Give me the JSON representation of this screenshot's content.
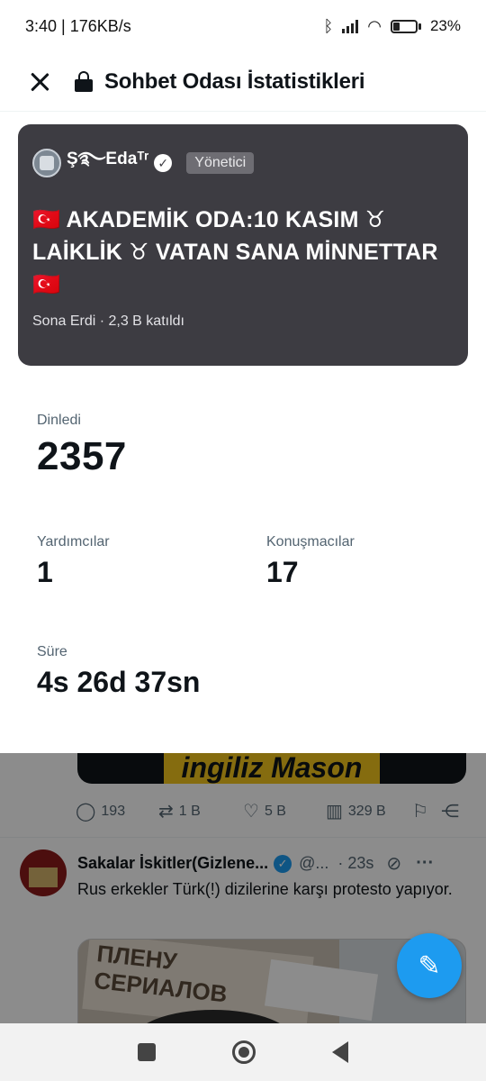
{
  "status_bar": {
    "time_speed": "3:40 | 176KB/s",
    "battery_percent": "23%"
  },
  "header": {
    "title": "Sohbet Odası İstatistikleri"
  },
  "space_card": {
    "host_name": "Ş࿐Edaᵀʳ",
    "role_badge": "Yönetici",
    "title": "🇹🇷 AKADEMİK ODA:10 KASIM ♉︎ LAİKLİK ♉︎ VATAN SANA MİNNETTAR 🇹🇷",
    "meta": "Sona Erdi · 2,3 B katıldı"
  },
  "stats": {
    "listened_label": "Dinledi",
    "listened_value": "2357",
    "helpers_label": "Yardımcılar",
    "helpers_value": "1",
    "speakers_label": "Konuşmacılar",
    "speakers_value": "17",
    "duration_label": "Süre",
    "duration_value": "4s 26d 37sn"
  },
  "feed": {
    "banner_text": "ingiliz Mason",
    "actions": {
      "replies": "193",
      "retweets": "1 B",
      "likes": "5 B",
      "views": "329 B"
    },
    "tweet": {
      "author": "Sakalar İskitler(Gizlene...",
      "handle": "@...",
      "time": "· 23s",
      "text": "Rus erkekler Türk(!) dizilerine karşı protesto yapıyor.",
      "media_sign_text": "ПЛЕНУ СЕРИАЛОВ"
    }
  },
  "colors": {
    "card_bg": "#3d3c42",
    "accent": "#1d9bf0",
    "muted_text": "#536471"
  }
}
